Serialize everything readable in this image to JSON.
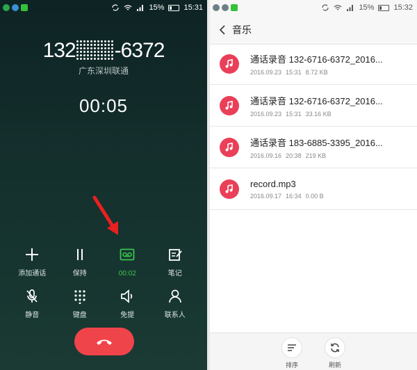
{
  "left": {
    "status_bar": {
      "battery": "15%",
      "time": "15:31"
    },
    "call": {
      "number_prefix": "132",
      "number_suffix": "-6372",
      "carrier": "广东深圳联通",
      "timer": "00:05"
    },
    "controls_row1": [
      {
        "label": "添加通话",
        "icon": "plus-icon"
      },
      {
        "label": "保持",
        "icon": "pause-icon"
      },
      {
        "label": "00:02",
        "icon": "recording-icon",
        "active": true
      },
      {
        "label": "笔记",
        "icon": "note-icon"
      }
    ],
    "controls_row2": [
      {
        "label": "静音",
        "icon": "mic-off-icon"
      },
      {
        "label": "键盘",
        "icon": "keypad-icon"
      },
      {
        "label": "免提",
        "icon": "speaker-icon"
      },
      {
        "label": "联系人",
        "icon": "contact-icon"
      }
    ],
    "colors": {
      "active_green": "#39c54a",
      "hangup_red": "#f0444b",
      "arrow_red": "#e8201f"
    }
  },
  "right": {
    "status_bar": {
      "battery": "15%",
      "time": "15:32"
    },
    "title": "音乐",
    "files": [
      {
        "name": "通话录音 132-6716-6372_2016...",
        "date": "2016.09.23",
        "time": "15:31",
        "size": "8.72 KB"
      },
      {
        "name": "通话录音 132-6716-6372_2016...",
        "date": "2016.09.23",
        "time": "15:31",
        "size": "33.16 KB"
      },
      {
        "name": "通话录音 183-6885-3395_2016...",
        "date": "2016.09.16",
        "time": "20:38",
        "size": "219 KB"
      },
      {
        "name": "record.mp3",
        "date": "2016.09.17",
        "time": "16:34",
        "size": "0.00 B"
      }
    ],
    "bottom": {
      "sort_label": "排序",
      "refresh_label": "刷新"
    },
    "colors": {
      "file_icon": "#ea3f58"
    }
  }
}
